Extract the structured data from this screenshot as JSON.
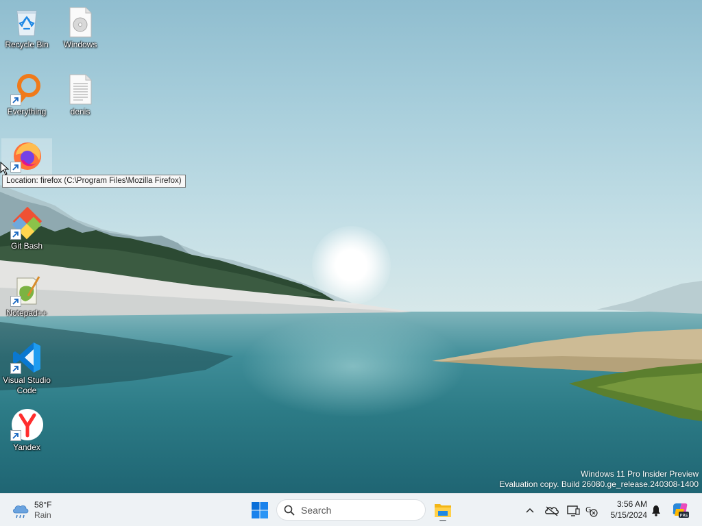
{
  "desktop": {
    "icons": [
      {
        "id": "recycle-bin",
        "label": "Recycle Bin"
      },
      {
        "id": "windows",
        "label": "Windows"
      },
      {
        "id": "everything",
        "label": "Everything"
      },
      {
        "id": "denis",
        "label": "denis"
      },
      {
        "id": "firefox",
        "label": ""
      },
      {
        "id": "git-bash",
        "label": "Git Bash"
      },
      {
        "id": "notepadpp",
        "label": "Notepad++"
      },
      {
        "id": "vscode",
        "label_line1": "Visual Studio",
        "label_line2": "Code"
      },
      {
        "id": "yandex",
        "label": "Yandex"
      }
    ],
    "tooltip": "Location: firefox (C:\\Program Files\\Mozilla Firefox)",
    "watermark_line1": "Windows 11 Pro Insider Preview",
    "watermark_line2": "Evaluation copy. Build 26080.ge_release.240308-1400"
  },
  "taskbar": {
    "weather": {
      "temp": "58°F",
      "condition": "Rain",
      "icon": "rain-cloud-icon"
    },
    "start_icon": "windows-logo-icon",
    "search_placeholder": "Search",
    "pinned": [
      {
        "name": "File Explorer",
        "icon": "folder-icon"
      }
    ],
    "tray_icons": [
      "chevron-up-icon",
      "onedrive-offline-icon",
      "display-icon",
      "language-icon"
    ],
    "clock_time": "3:56 AM",
    "clock_date": "5/15/2024",
    "notification_icon": "bell-icon",
    "copilot_icon": "copilot-pre-icon"
  },
  "colors": {
    "accent": "#0078d4",
    "taskbar_bg": "#eef2f5"
  }
}
